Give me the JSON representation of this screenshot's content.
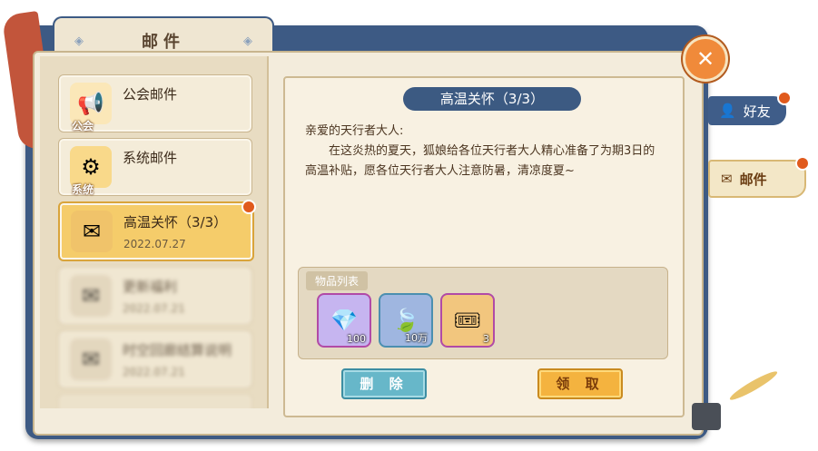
{
  "header": {
    "title": "邮件"
  },
  "sidebar": {
    "categories": [
      {
        "label": "公会邮件",
        "badge": "公会",
        "icon": "megaphone-icon"
      },
      {
        "label": "系统邮件",
        "badge": "系统",
        "icon": "gear-icon"
      }
    ],
    "mails": [
      {
        "title": "高温关怀（3/3）",
        "date": "2022.07.27",
        "active": true
      },
      {
        "title": "更新福利",
        "date": "2022.07.21",
        "active": false
      },
      {
        "title": "时空回廊结算说明",
        "date": "2022.07.21",
        "active": false
      }
    ]
  },
  "mail_detail": {
    "subject": "高温关怀（3/3）",
    "greeting": "亲爱的天行者大人:",
    "body": "在这炎热的夏天，狐娘给各位天行者大人精心准备了为期3日的高温补贴，愿各位天行者大人注意防暑，清凉度夏~",
    "items_label": "物品列表",
    "items": [
      {
        "icon": "gem-icon",
        "qty": "100"
      },
      {
        "icon": "leaf-icon",
        "qty": "10万"
      },
      {
        "icon": "ticket-icon",
        "qty": "3"
      }
    ],
    "delete_label": "删 除",
    "claim_label": "领 取"
  },
  "side_tabs": {
    "friends": "好友",
    "mail": "邮件"
  },
  "colors": {
    "accent_blue": "#3d5a84",
    "highlight_gold": "#f5cc6a",
    "notify_red": "#e05a1d"
  }
}
